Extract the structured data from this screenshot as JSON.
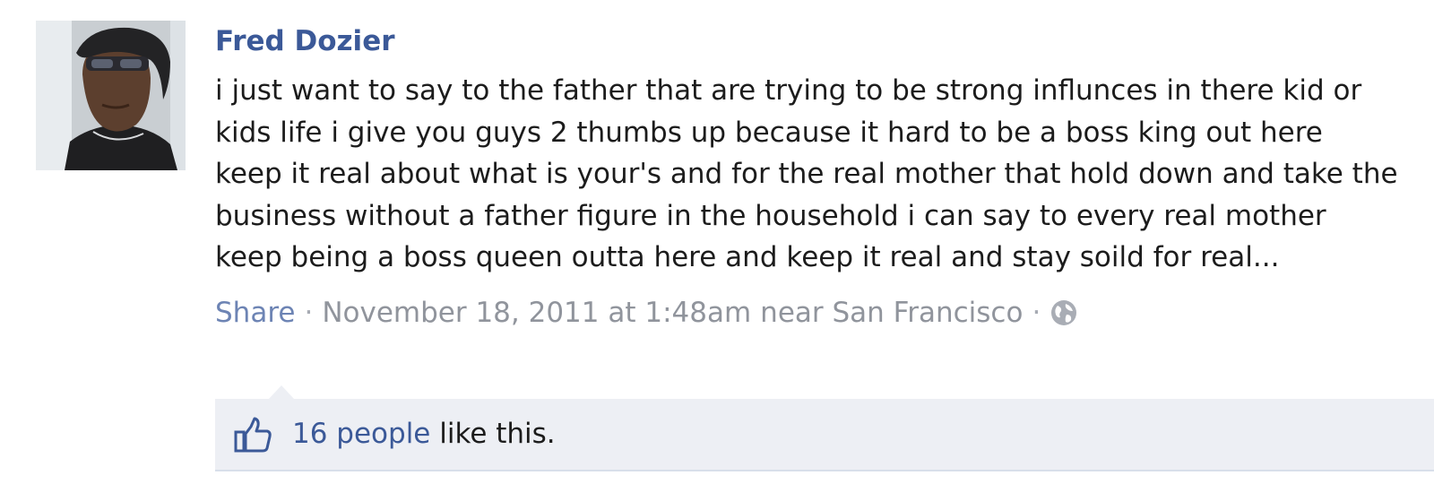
{
  "post": {
    "author": "Fred Dozier",
    "message": "i just want to say to the father that are trying to be strong influnces in there kid or kids life i give you guys 2 thumbs up because it hard to be a boss king out here keep it real about what is your's and for the real mother that hold down and take the business without a father figure in the household i can say to every real mother keep being a boss queen outta here and keep it real and stay soild for real...",
    "share_label": "Share",
    "separator": "·",
    "timestamp": "November 18, 2011 at 1:48am",
    "location": "near San Francisco",
    "privacy_icon": "globe-icon"
  },
  "likes": {
    "icon": "thumbs-up-icon",
    "people_link": "16 people",
    "suffix": " like this."
  },
  "colors": {
    "link": "#3b5998",
    "muted_link": "#6d84b4",
    "meta_text": "#90949c",
    "likes_bg": "#edeff4"
  }
}
